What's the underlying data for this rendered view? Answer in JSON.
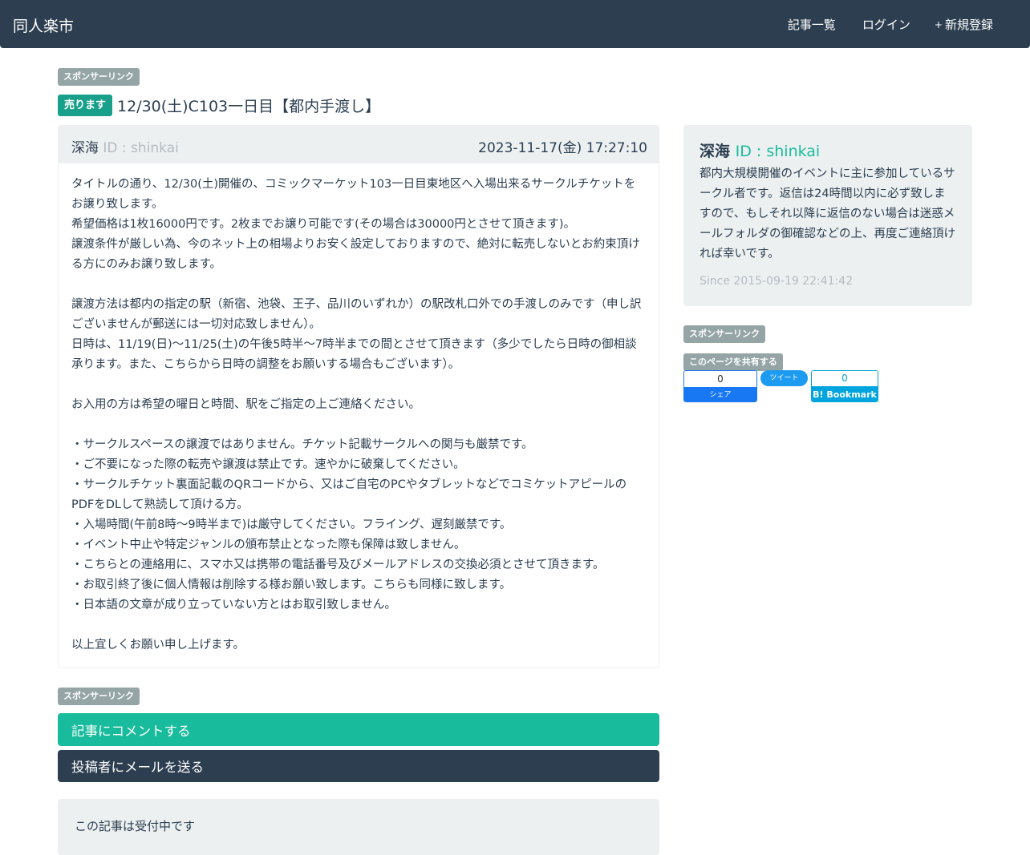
{
  "nav": {
    "brand": "同人楽市",
    "links": [
      {
        "icon": "list-icon",
        "glyph": "",
        "label": "記事一覧"
      },
      {
        "icon": "login-icon",
        "glyph": "",
        "label": "ログイン"
      },
      {
        "icon": "plus-icon",
        "glyph": "+",
        "label": "新規登録"
      }
    ]
  },
  "sponsor_label": "スポンサーリンク",
  "post": {
    "badge": "売ります",
    "title": "12/30(土)C103一日目【都内手渡し】",
    "author_name": "深海",
    "author_id": "ID : shinkai",
    "date": "2023-11-17(金) 17:27:10",
    "user_icon": "",
    "clock_icon": "",
    "body": "タイトルの通り、12/30(土)開催の、コミックマーケット103一日目東地区へ入場出来るサークルチケットをお譲り致します。\n希望価格は1枚16000円です。2枚までお譲り可能です(その場合は30000円とさせて頂きます)。\n譲渡条件が厳しい為、今のネット上の相場よりお安く設定しておりますので、絶対に転売しないとお約束頂ける方にのみお譲り致します。\n\n譲渡方法は都内の指定の駅（新宿、池袋、王子、品川のいずれか）の駅改札口外での手渡しのみです（申し訳ございませんが郵送には一切対応致しません）。\n日時は、11/19(日)〜11/25(土)の午後5時半〜7時半までの間とさせて頂きます（多少でしたら日時の御相談承ります。また、こちらから日時の調整をお願いする場合もございます）。\n\nお入用の方は希望の曜日と時間、駅をご指定の上ご連絡ください。\n\n・サークルスペースの譲渡ではありません。チケット記載サークルへの関与も厳禁です。\n・ご不要になった際の転売や譲渡は禁止です。速やかに破棄してください。\n・サークルチケット裏面記載のQRコードから、又はご自宅のPCやタブレットなどでコミケットアピールのPDFをDLして熟読して頂ける方。\n・入場時間(午前8時〜9時半まで)は厳守してください。フライング、遅刻厳禁です。\n・イベント中止や特定ジャンルの頒布禁止となった際も保障は致しません。\n・こちらとの連絡用に、スマホ又は携帯の電話番号及びメールアドレスの交換必須とさせて頂きます。\n・お取引終了後に個人情報は削除する様お願い致します。こちらも同様に致します。\n・日本語の文章が成り立っていない方とはお取引致しません。\n\n以上宜しくお願い申し上げます。"
  },
  "actions": {
    "comment": "記事にコメントする",
    "mail": "投稿者にメールを送る"
  },
  "status": "この記事は受付中です",
  "sidebar": {
    "name": "深海",
    "id": "ID : shinkai",
    "bio": "都内大規模開催のイベントに主に参加しているサークル者です。返信は24時間以内に必ず致しますので、もしそれ以降に返信のない場合は迷惑メールフォルダの御確認などの上、再度ご連絡頂ければ幸いです。",
    "since": "Since 2015-09-19 22:41:42",
    "share_label": "このページを共有する"
  },
  "share": {
    "fb_count": "0",
    "fb_label": "シェア",
    "tw_label": "ツイート",
    "hb_count": "0",
    "hb_label": "B! Bookmark"
  },
  "colors": {
    "navbar": "#2c3e50",
    "accent": "#18bc9c",
    "sell_badge": "#18a08a",
    "muted": "#b4bcc2"
  }
}
